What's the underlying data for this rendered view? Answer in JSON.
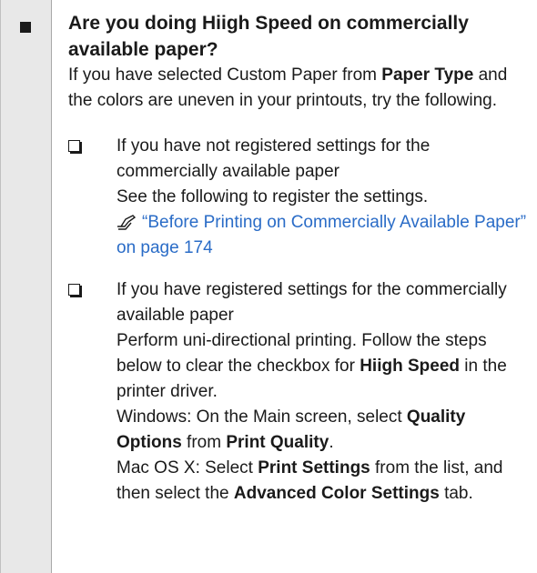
{
  "heading": "Are you doing Hiigh Speed on commercially available paper?",
  "intro": {
    "p1": "If you have selected Custom Paper from ",
    "b1": "Paper Type",
    "p2": " and the colors are uneven in your printouts, try the following."
  },
  "items": [
    {
      "line1": "If you have not registered settings for the commercially available paper",
      "line2": "See the following to register the settings.",
      "link": "“Before Printing on Commercially Available Paper” on page 174",
      "icon": "reference-hand-icon"
    },
    {
      "line1": "If you have registered settings for the commercially available paper",
      "s1": "Perform uni-directional printing. Follow the steps below to clear the checkbox for ",
      "s1b": "Hiigh Speed",
      "s1e": " in the printer driver.",
      "w1": "Windows: On the Main screen, select ",
      "w1b": "Quality Options",
      "w2": " from ",
      "w2b": "Print Quality",
      "w3": ".",
      "m1": "Mac OS X: Select ",
      "m1b": "Print Settings",
      "m2": " from the list, and then select the ",
      "m2b": "Advanced Color Settings",
      "m3": " tab."
    }
  ]
}
